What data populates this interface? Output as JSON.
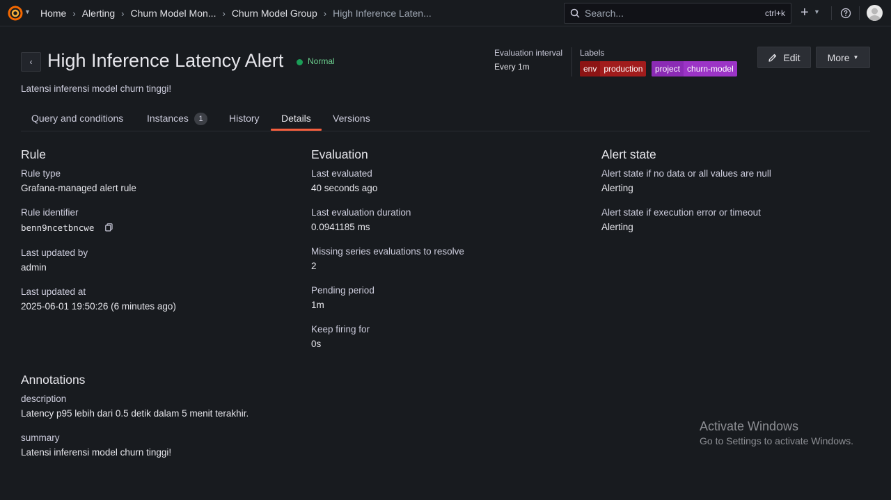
{
  "breadcrumbs": [
    "Home",
    "Alerting",
    "Churn Model Mon...",
    "Churn Model Group",
    "High Inference Laten..."
  ],
  "search": {
    "placeholder": "Search...",
    "shortcut": "ctrl+k"
  },
  "header": {
    "title": "High Inference Latency Alert",
    "state": "Normal",
    "state_color": "#1a9e57",
    "subtitle": "Latensi inferensi model churn tinggi!",
    "evaluation_interval_label": "Evaluation interval",
    "evaluation_interval_value": "Every 1m",
    "labels_label": "Labels",
    "labels": [
      {
        "key": "env",
        "value": "production",
        "color": "#a11c1c"
      },
      {
        "key": "project",
        "value": "churn-model",
        "color": "#9c34c6"
      }
    ],
    "edit_label": "Edit",
    "more_label": "More"
  },
  "tabs": [
    {
      "label": "Query and conditions"
    },
    {
      "label": "Instances",
      "count": "1"
    },
    {
      "label": "History"
    },
    {
      "label": "Details",
      "active": true
    },
    {
      "label": "Versions"
    }
  ],
  "rule": {
    "heading": "Rule",
    "fields": [
      {
        "label": "Rule type",
        "value": "Grafana-managed alert rule"
      },
      {
        "label": "Rule identifier",
        "value": "benn9ncetbncwe"
      },
      {
        "label": "Last updated by",
        "value": "admin"
      },
      {
        "label": "Last updated at",
        "value": "2025-06-01 19:50:26 (6 minutes ago)"
      }
    ]
  },
  "evaluation": {
    "heading": "Evaluation",
    "fields": [
      {
        "label": "Last evaluated",
        "value": "40 seconds ago"
      },
      {
        "label": "Last evaluation duration",
        "value": "0.0941185 ms"
      },
      {
        "label": "Missing series evaluations to resolve",
        "value": "2"
      },
      {
        "label": "Pending period",
        "value": "1m"
      },
      {
        "label": "Keep firing for",
        "value": "0s"
      }
    ]
  },
  "alert_state": {
    "heading": "Alert state",
    "fields": [
      {
        "label": "Alert state if no data or all values are null",
        "value": "Alerting"
      },
      {
        "label": "Alert state if execution error or timeout",
        "value": "Alerting"
      }
    ]
  },
  "annotations": {
    "heading": "Annotations",
    "fields": [
      {
        "label": "description",
        "value": "Latency p95 lebih dari 0.5 detik dalam 5 menit terakhir."
      },
      {
        "label": "summary",
        "value": "Latensi inferensi model churn tinggi!"
      }
    ]
  },
  "watermark": {
    "title": "Activate Windows",
    "subtitle": "Go to Settings to activate Windows."
  },
  "accent_color": "#f55f3e"
}
